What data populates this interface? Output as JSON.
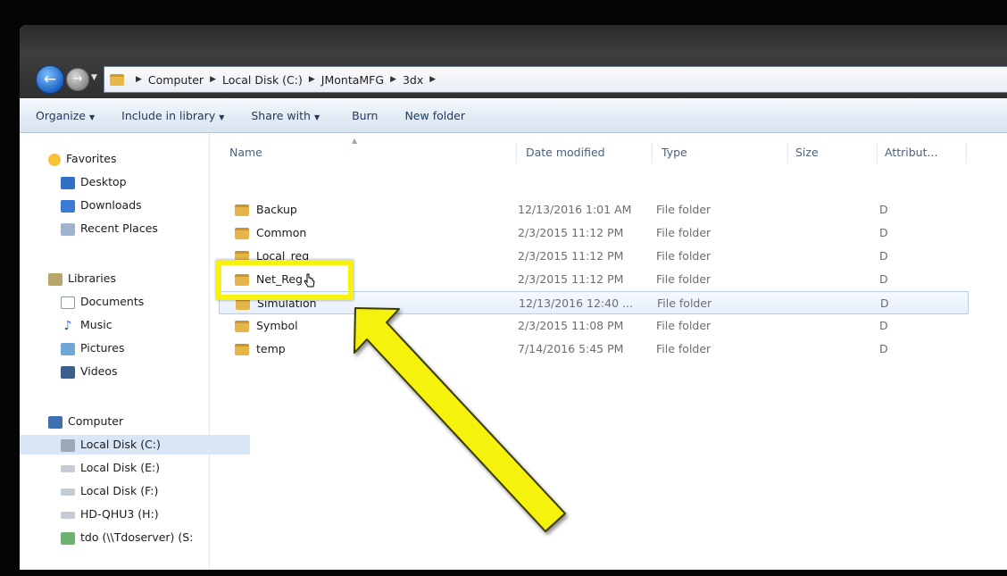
{
  "address": {
    "crumbs": [
      "Computer",
      "Local Disk (C:)",
      "JMontaMFG",
      "3dx"
    ]
  },
  "toolbar": {
    "organize": "Organize",
    "include_in_library": "Include in library",
    "share_with": "Share with",
    "burn": "Burn",
    "new_folder": "New folder"
  },
  "nav": {
    "favorites": "Favorites",
    "desktop": "Desktop",
    "downloads": "Downloads",
    "recent_places": "Recent Places",
    "libraries": "Libraries",
    "documents": "Documents",
    "music": "Music",
    "pictures": "Pictures",
    "videos": "Videos",
    "computer": "Computer",
    "local_c": "Local Disk (C:)",
    "local_e": "Local Disk (E:)",
    "local_f": "Local Disk (F:)",
    "hd_h": "HD-QHU3 (H:)",
    "tdo": "tdo (\\\\Tdoserver) (S:"
  },
  "columns": {
    "name": "Name",
    "date_modified": "Date modified",
    "type": "Type",
    "size": "Size",
    "attributes": "Attribut..."
  },
  "files": [
    {
      "name": "Backup",
      "date": "12/13/2016 1:01 AM",
      "type": "File folder",
      "attr": "D"
    },
    {
      "name": "Common",
      "date": "2/3/2015 11:12 PM",
      "type": "File folder",
      "attr": "D"
    },
    {
      "name": "Local_reg",
      "date": "2/3/2015 11:12 PM",
      "type": "File folder",
      "attr": "D"
    },
    {
      "name": "Net_Reg",
      "date": "2/3/2015 11:12 PM",
      "type": "File folder",
      "attr": "D"
    },
    {
      "name": "Simulation",
      "date": "12/13/2016 12:40 ...",
      "type": "File folder",
      "attr": "D"
    },
    {
      "name": "Symbol",
      "date": "2/3/2015 11:08 PM",
      "type": "File folder",
      "attr": "D"
    },
    {
      "name": "temp",
      "date": "7/14/2016 5:45 PM",
      "type": "File folder",
      "attr": "D"
    }
  ],
  "colors": {
    "highlight": "#f5f20f",
    "selection": "#d9e6f5"
  }
}
